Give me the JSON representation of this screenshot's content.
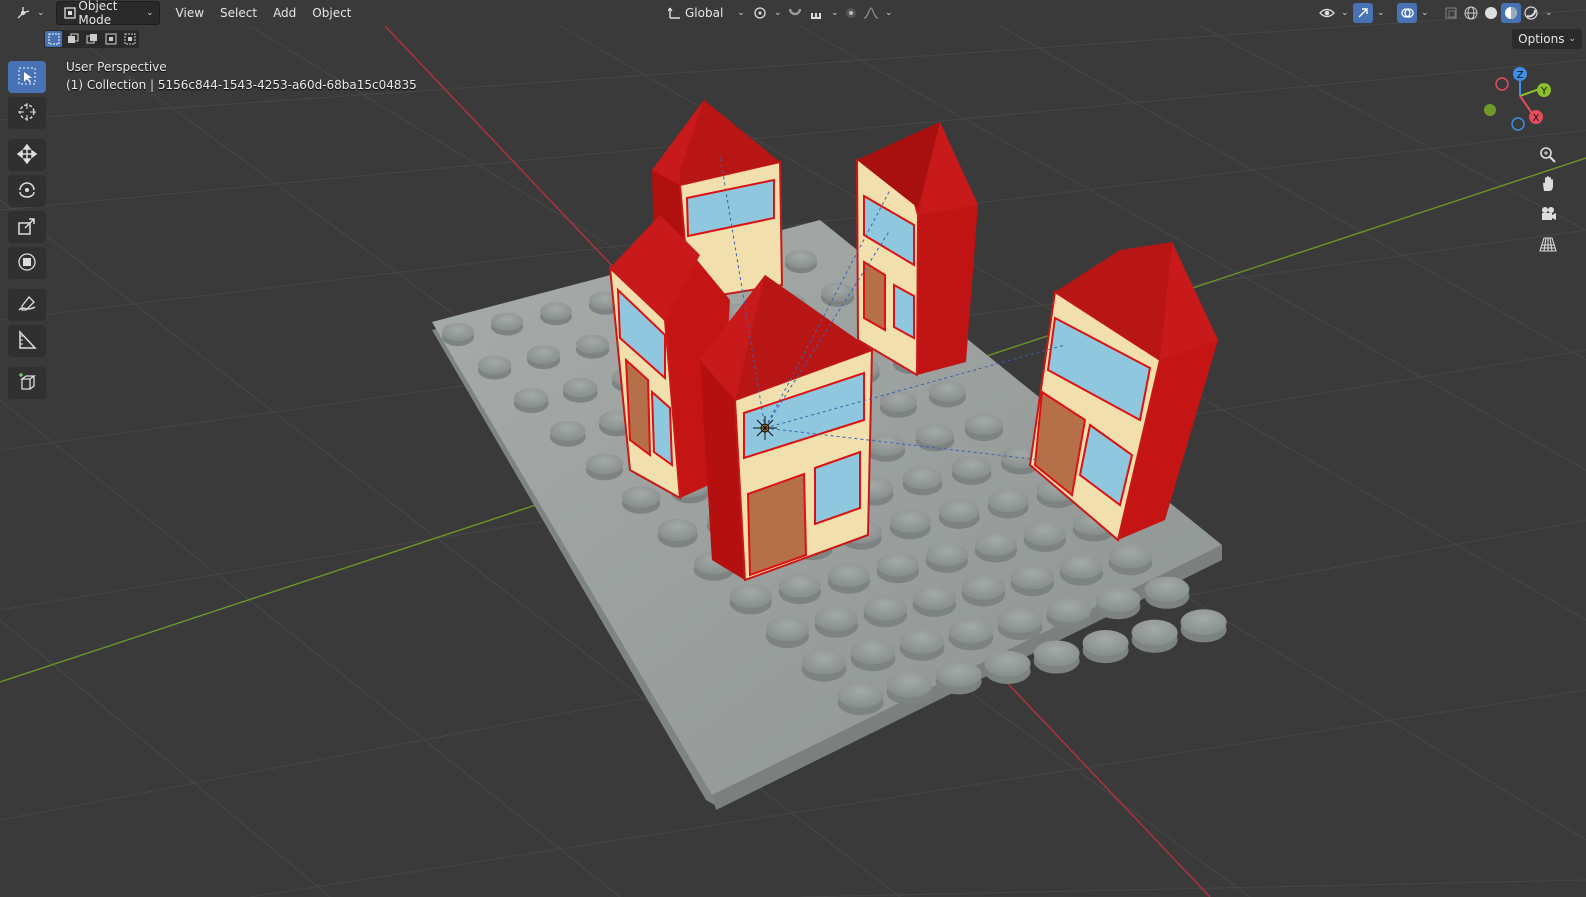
{
  "header": {
    "editor_type_icon": "3d-viewport-icon",
    "mode_label": "Object Mode",
    "menus": [
      "View",
      "Select",
      "Add",
      "Object"
    ],
    "transform_orientation": "Global"
  },
  "viewport": {
    "perspective_label": "User Perspective",
    "collection_label": "(1) Collection | 5156c844-1543-4253-a60d-68ba15c04835",
    "options_label": "Options"
  },
  "gizmo": {
    "axes": [
      "X",
      "Y",
      "Z"
    ],
    "colors": {
      "x": "#e74c5c",
      "y": "#8cbf2f",
      "z": "#3d8ee8"
    }
  },
  "tools": [
    "select-box-icon",
    "cursor-icon",
    "move-icon",
    "rotate-icon",
    "scale-icon",
    "transform-icon",
    "annotate-icon",
    "measure-icon",
    "add-cube-icon"
  ],
  "colors": {
    "background": "#3a3a3a",
    "grid": "#454545",
    "x_axis": "#b5323c",
    "y_axis": "#6b9628",
    "accent": "#4772b3",
    "roof": "#c21414",
    "wall": "#f3e2b0",
    "window": "#8fc7df",
    "door": "#b5704a",
    "baseplate": "#9aa19f"
  }
}
